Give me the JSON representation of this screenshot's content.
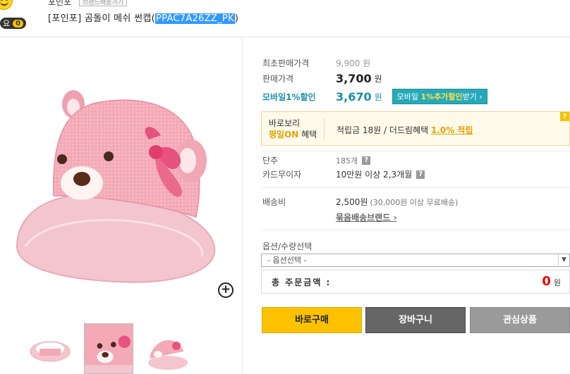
{
  "header": {
    "like_label": "요",
    "like_count": "0",
    "seller_name": "포인포",
    "seller_badge": "브랜드배송가기",
    "product_title_prefix": "[포인포] 곰돌이 메쉬 썬캡(",
    "product_code": "PPAC7A26ZZ_PK",
    "product_title_suffix": ")"
  },
  "price": {
    "orig_label": "최초판매가격",
    "orig_value": "9,900 원",
    "sale_label": "판매가격",
    "sale_value": "3,700",
    "won": "원",
    "mobile_label": "모바일1%할인",
    "mobile_value": "3,670",
    "mobile_btn_prefix": "모바일 ",
    "mobile_btn_highlight": "1%추가할인",
    "mobile_btn_suffix": "받기 ›"
  },
  "benefit": {
    "line1": "바로보리",
    "line2_on": "평일ON",
    "line2_rest": " 혜택",
    "text": "적립금 18원 / 더드림혜택 ",
    "link": "1.0% 적립",
    "q": "?"
  },
  "details": {
    "unit_label": "단추",
    "unit_value": "185개",
    "card_label": "카드무이자",
    "card_value": "10만원 이상 2,3개월",
    "ship_label": "배송비",
    "ship_value": "2,500원",
    "ship_note": "(30,000원 이상 무료배송)",
    "bundle_link": "묶음배송브랜드 ›"
  },
  "options": {
    "label": "옵션/수량선택",
    "select_value": "- 옵션선택 -",
    "total_label": "총 주문금액 :",
    "total_value": "0",
    "total_unit": "원"
  },
  "buttons": {
    "buy": "바로구매",
    "cart": "장바구니",
    "wish": "관심상품"
  },
  "colors": {
    "buy": "#fcc200",
    "cart": "#666666",
    "wish": "#9a9a9a",
    "mobile_accent": "#1a8fa8",
    "benefit_bg": "#fffaea"
  }
}
